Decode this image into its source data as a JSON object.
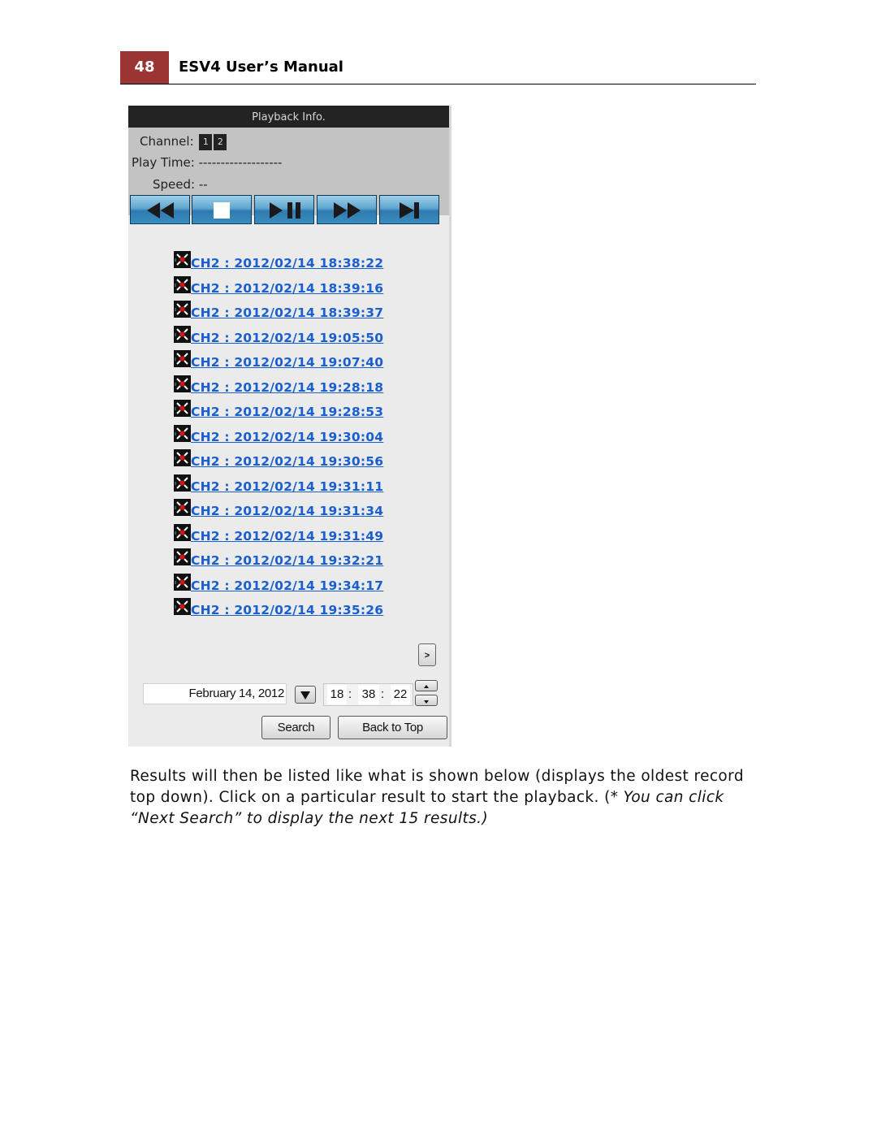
{
  "header": {
    "page_number": "48",
    "title": "ESV4 User’s Manual",
    "accent_color": "#9b3533"
  },
  "panel": {
    "title": "Playback Info.",
    "channel_label": "Channel:",
    "channels": [
      "1",
      "2"
    ],
    "play_time_label": "Play Time:",
    "play_time_value": "-------------------",
    "speed_label": "Speed:",
    "speed_value": "--",
    "controls": [
      {
        "name": "rewind",
        "icon": "rewind-icon"
      },
      {
        "name": "stop",
        "icon": "stop-icon"
      },
      {
        "name": "play-pause",
        "icon": "play-pause-icon"
      },
      {
        "name": "fast-forward",
        "icon": "fast-forward-icon"
      },
      {
        "name": "next-frame",
        "icon": "skip-forward-icon"
      }
    ],
    "results": [
      "CH2 : 2012/02/14 18:38:22",
      "CH2 : 2012/02/14 18:39:16",
      "CH2 : 2012/02/14 18:39:37",
      "CH2 : 2012/02/14 19:05:50",
      "CH2 : 2012/02/14 19:07:40",
      "CH2 : 2012/02/14 19:28:18",
      "CH2 : 2012/02/14 19:28:53",
      "CH2 : 2012/02/14 19:30:04",
      "CH2 : 2012/02/14 19:30:56",
      "CH2 : 2012/02/14 19:31:11",
      "CH2 : 2012/02/14 19:31:34",
      "CH2 : 2012/02/14 19:31:49",
      "CH2 : 2012/02/14 19:32:21",
      "CH2 : 2012/02/14 19:34:17",
      "CH2 : 2012/02/14 19:35:26"
    ],
    "result_icon": "recording-event-icon",
    "link_color": "#1a5fd0",
    "next_button_label": ">",
    "date_value": "February 14, 2012",
    "time": {
      "hour": "18",
      "minute": "38",
      "second": "22",
      "separator": ":"
    },
    "search_label": "Search",
    "back_to_top_label": "Back to Top"
  },
  "body": {
    "text_normal": "Results will then be listed like what is shown below (displays the oldest record top down). Click on a particular result to start the playback. (*",
    "text_italic": "You can click “Next Search” to display the next 15 results.)"
  }
}
